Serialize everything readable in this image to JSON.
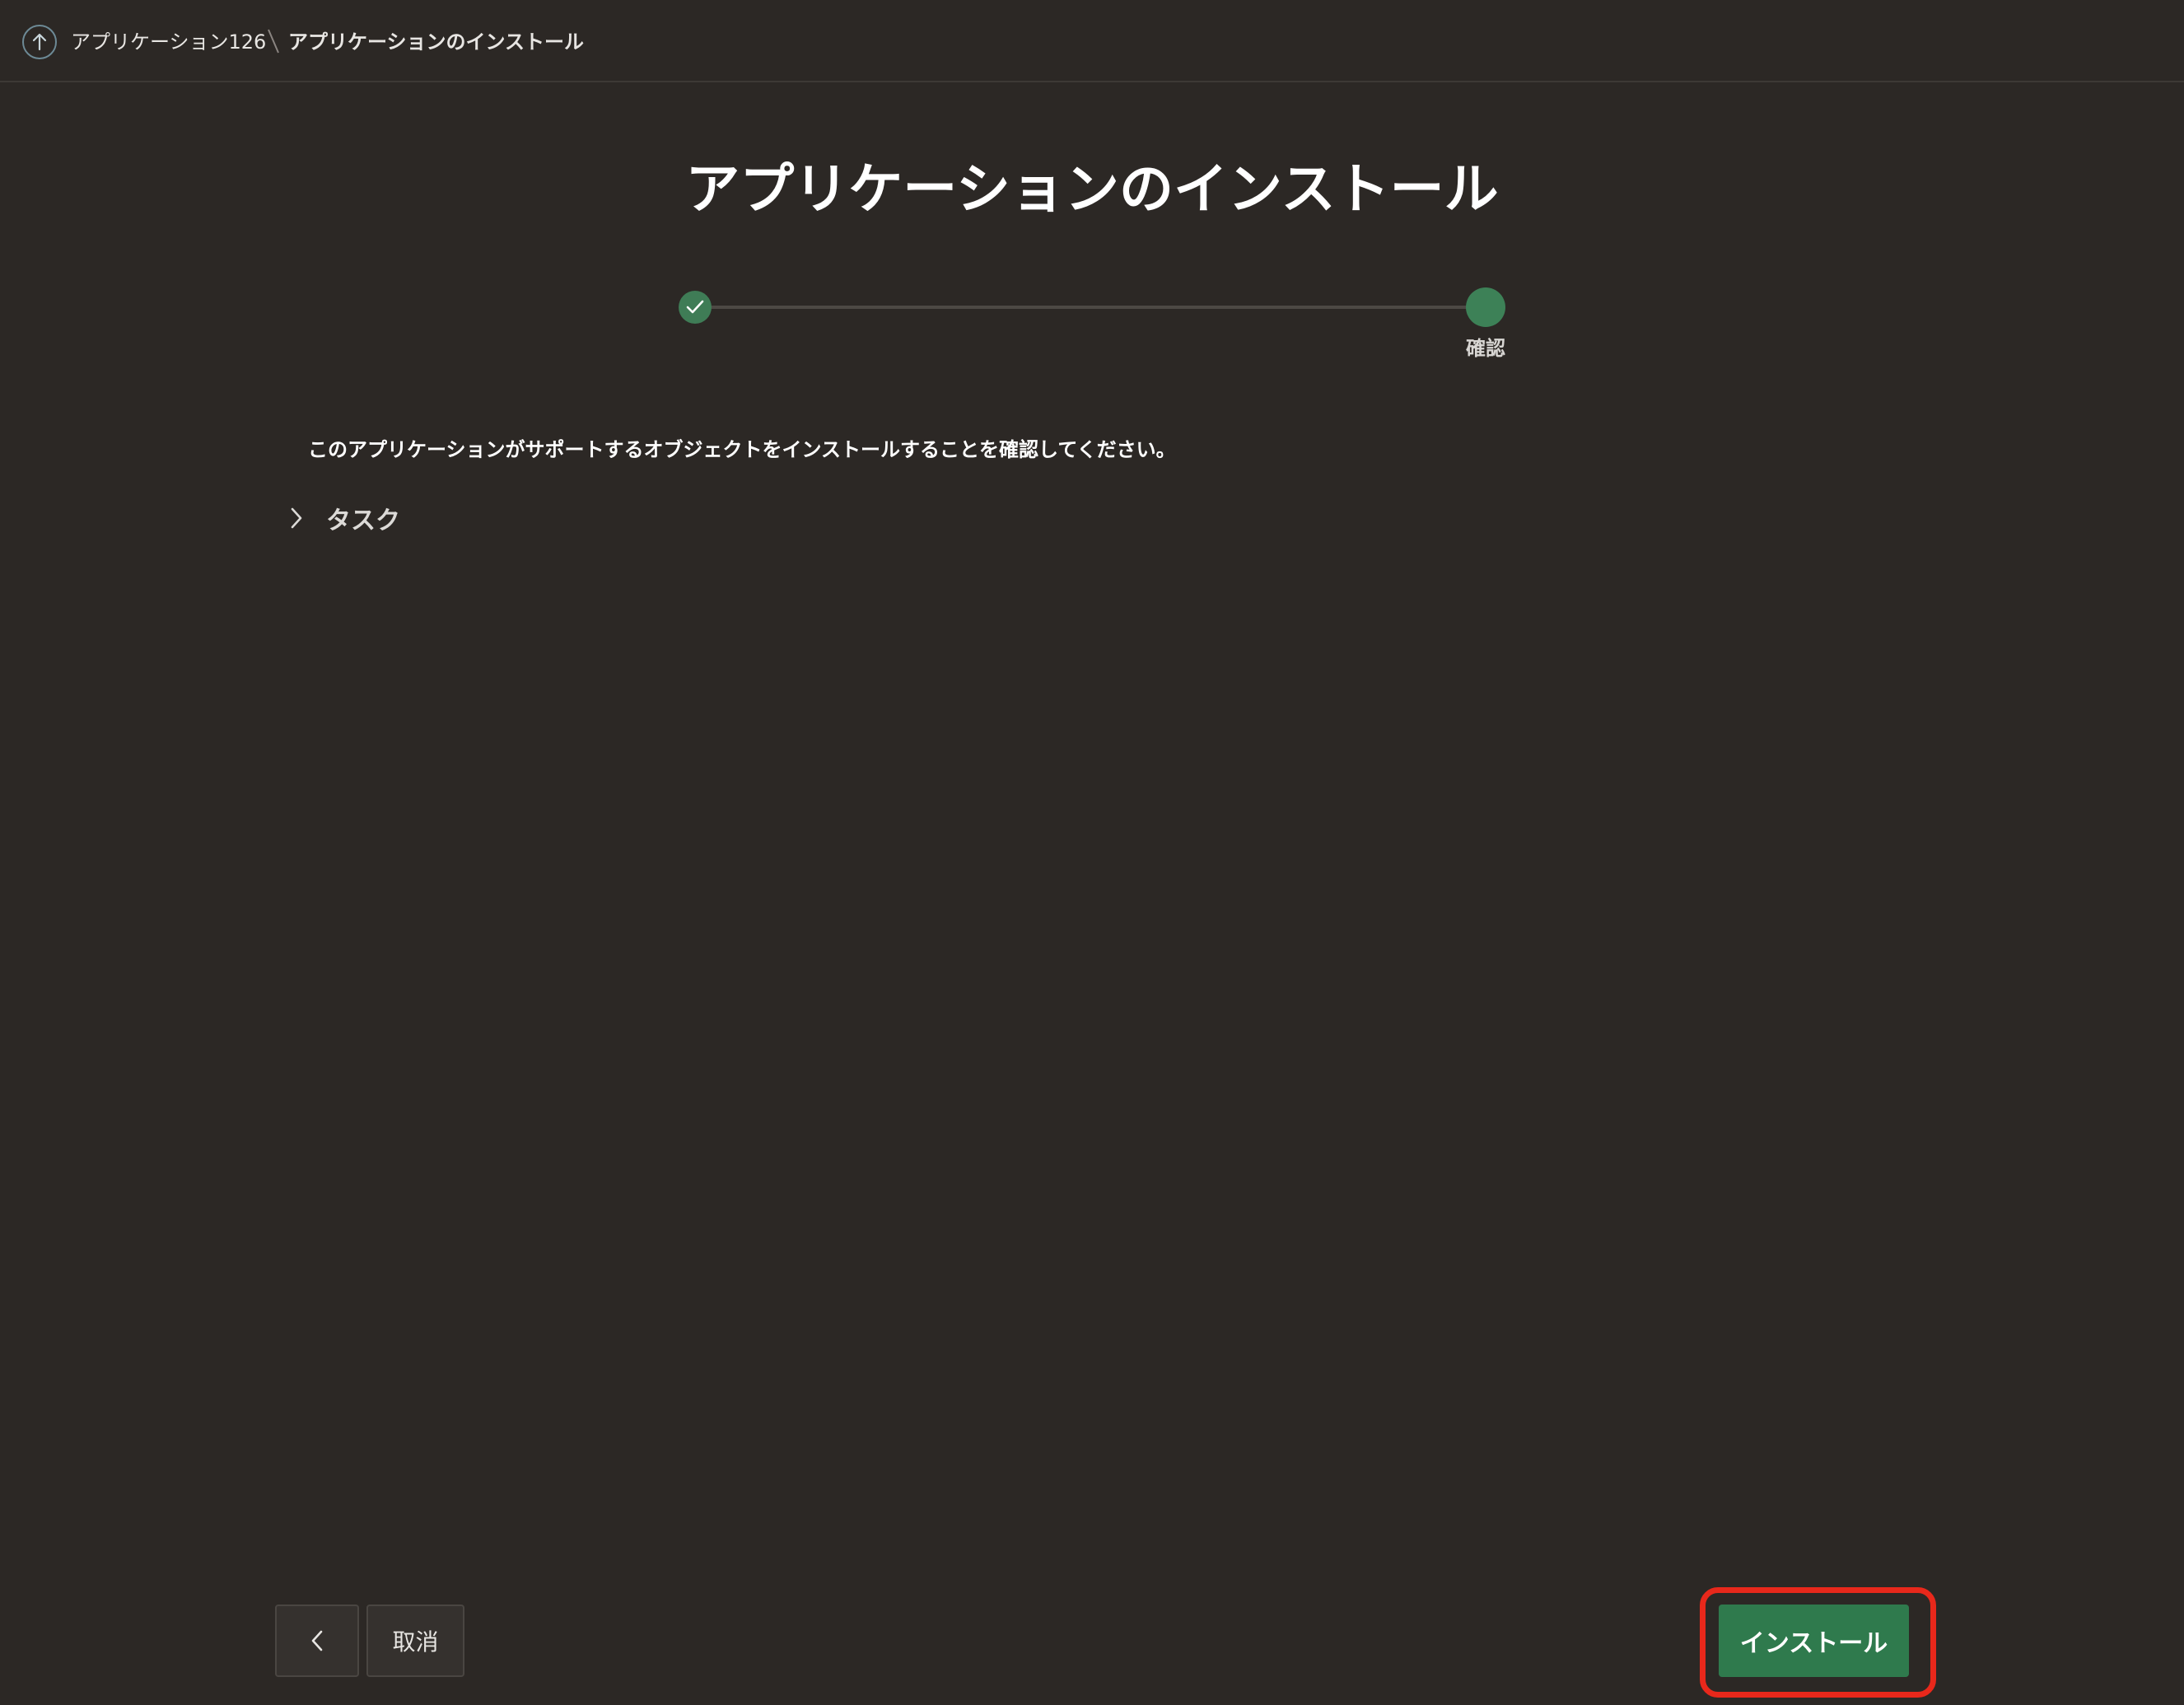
{
  "breadcrumb": {
    "parent": "アプリケーション126",
    "current": "アプリケーションのインストール",
    "up_icon": "arrow-up-icon"
  },
  "page": {
    "title": "アプリケーションのインストール"
  },
  "wizard": {
    "steps": [
      {
        "label": "",
        "state": "complete",
        "icon": "check-icon"
      },
      {
        "label": "確認",
        "state": "current"
      }
    ],
    "colors": {
      "complete": "#3f7c56",
      "current": "#3d8157",
      "track": "#4d4944"
    }
  },
  "content": {
    "instruction": "このアプリケーションがサポートするオブジェクトをインストールすることを確認してください。",
    "region": {
      "label": "タスク",
      "expanded": false,
      "icon": "chevron-right-icon"
    }
  },
  "footer": {
    "back_icon": "chevron-left-icon",
    "cancel_label": "取消",
    "install_label": "インストール"
  },
  "colors": {
    "background": "#2c2825",
    "primary": "#2f7a4d",
    "highlight": "#e8281b"
  }
}
